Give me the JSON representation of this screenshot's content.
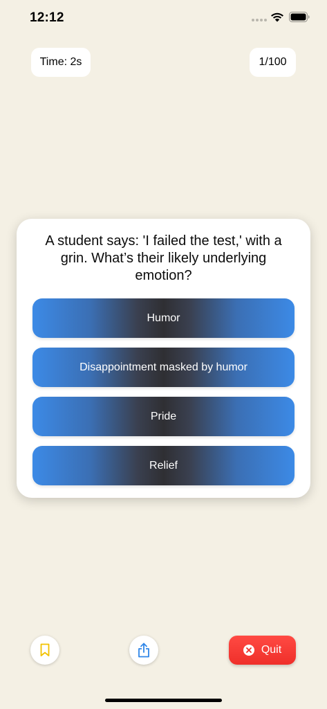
{
  "status_bar": {
    "time": "12:12"
  },
  "header": {
    "timer_label": "Time: 2s",
    "progress_label": "1/100"
  },
  "question": {
    "text": "A student says: 'I failed the test,' with a grin. What’s their likely underlying emotion?",
    "options": [
      {
        "label": "Humor"
      },
      {
        "label": "Disappointment masked by humor"
      },
      {
        "label": "Pride"
      },
      {
        "label": "Relief"
      }
    ]
  },
  "footer": {
    "bookmark_icon": "bookmark-icon",
    "share_icon": "share-icon",
    "quit_label": "Quit",
    "quit_icon": "close-circle-icon"
  },
  "colors": {
    "background": "#f4f0e4",
    "option_edge": "#3c8ae6",
    "option_center": "#2f2f33",
    "quit": "#ff4a43",
    "bookmark": "#f2c200",
    "share": "#2f86e8"
  }
}
